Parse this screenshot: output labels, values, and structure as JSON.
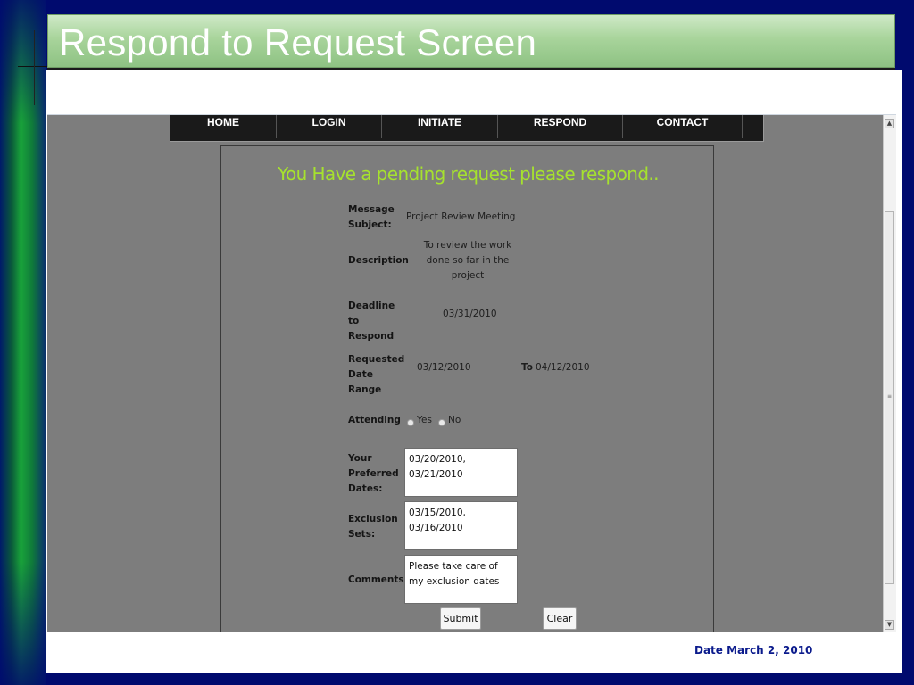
{
  "slide": {
    "title": "Respond to Request Screen",
    "footer_date": "Date  March 2, 2010"
  },
  "nav": {
    "items": [
      "HOME",
      "LOGIN",
      "INITIATE",
      "RESPOND",
      "CONTACT"
    ]
  },
  "page": {
    "heading": "You Have a pending request please respond.."
  },
  "form": {
    "message_subject": {
      "label": "Message Subject:",
      "value": "Project Review Meeting"
    },
    "description": {
      "label": "Description",
      "value": "To review the work done so far in the project"
    },
    "deadline": {
      "label": "Deadline to Respond",
      "value": "03/31/2010"
    },
    "date_range": {
      "label": "Requested Date Range",
      "from": "03/12/2010",
      "to_label": "To",
      "to": "04/12/2010"
    },
    "attending": {
      "label": "Attending",
      "options": [
        "Yes",
        "No"
      ],
      "selected": ""
    },
    "preferred_dates": {
      "label": "Your Preferred Dates:",
      "value": "03/20/2010, 03/21/2010"
    },
    "exclusion_sets": {
      "label": "Exclusion Sets:",
      "value": "03/15/2010, 03/16/2010"
    },
    "comments": {
      "label": "Comments:",
      "value": "Please take care of my exclusion dates"
    },
    "submit_label": "Submit",
    "clear_label": "Clear"
  },
  "colors": {
    "slide_background": "#000a6e",
    "title_bar": "#a8d49b",
    "browser_background": "#7d7d7d",
    "heading": "#a6e22e",
    "footer_text": "#0a1a8c"
  },
  "icons": [
    "scroll-up-arrow-icon",
    "scroll-down-arrow-icon",
    "scroll-grip-icon"
  ]
}
